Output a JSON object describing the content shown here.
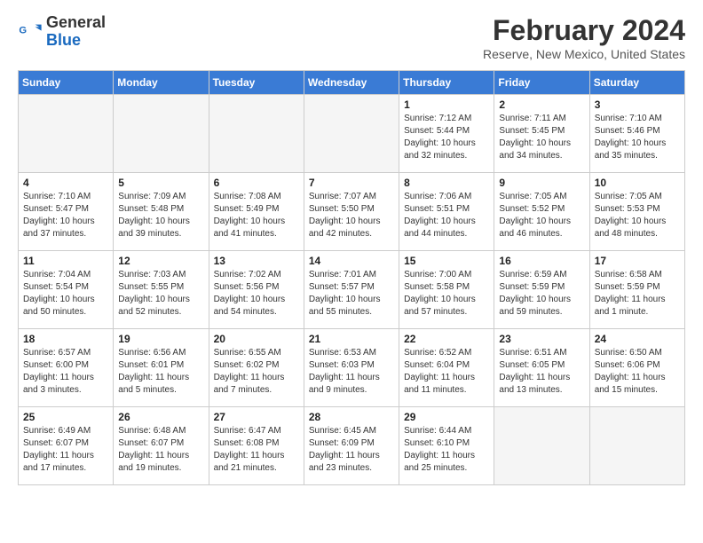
{
  "logo": {
    "line1": "General",
    "line2": "Blue"
  },
  "title": "February 2024",
  "subtitle": "Reserve, New Mexico, United States",
  "weekdays": [
    "Sunday",
    "Monday",
    "Tuesday",
    "Wednesday",
    "Thursday",
    "Friday",
    "Saturday"
  ],
  "weeks": [
    [
      {
        "day": "",
        "info": ""
      },
      {
        "day": "",
        "info": ""
      },
      {
        "day": "",
        "info": ""
      },
      {
        "day": "",
        "info": ""
      },
      {
        "day": "1",
        "info": "Sunrise: 7:12 AM\nSunset: 5:44 PM\nDaylight: 10 hours\nand 32 minutes."
      },
      {
        "day": "2",
        "info": "Sunrise: 7:11 AM\nSunset: 5:45 PM\nDaylight: 10 hours\nand 34 minutes."
      },
      {
        "day": "3",
        "info": "Sunrise: 7:10 AM\nSunset: 5:46 PM\nDaylight: 10 hours\nand 35 minutes."
      }
    ],
    [
      {
        "day": "4",
        "info": "Sunrise: 7:10 AM\nSunset: 5:47 PM\nDaylight: 10 hours\nand 37 minutes."
      },
      {
        "day": "5",
        "info": "Sunrise: 7:09 AM\nSunset: 5:48 PM\nDaylight: 10 hours\nand 39 minutes."
      },
      {
        "day": "6",
        "info": "Sunrise: 7:08 AM\nSunset: 5:49 PM\nDaylight: 10 hours\nand 41 minutes."
      },
      {
        "day": "7",
        "info": "Sunrise: 7:07 AM\nSunset: 5:50 PM\nDaylight: 10 hours\nand 42 minutes."
      },
      {
        "day": "8",
        "info": "Sunrise: 7:06 AM\nSunset: 5:51 PM\nDaylight: 10 hours\nand 44 minutes."
      },
      {
        "day": "9",
        "info": "Sunrise: 7:05 AM\nSunset: 5:52 PM\nDaylight: 10 hours\nand 46 minutes."
      },
      {
        "day": "10",
        "info": "Sunrise: 7:05 AM\nSunset: 5:53 PM\nDaylight: 10 hours\nand 48 minutes."
      }
    ],
    [
      {
        "day": "11",
        "info": "Sunrise: 7:04 AM\nSunset: 5:54 PM\nDaylight: 10 hours\nand 50 minutes."
      },
      {
        "day": "12",
        "info": "Sunrise: 7:03 AM\nSunset: 5:55 PM\nDaylight: 10 hours\nand 52 minutes."
      },
      {
        "day": "13",
        "info": "Sunrise: 7:02 AM\nSunset: 5:56 PM\nDaylight: 10 hours\nand 54 minutes."
      },
      {
        "day": "14",
        "info": "Sunrise: 7:01 AM\nSunset: 5:57 PM\nDaylight: 10 hours\nand 55 minutes."
      },
      {
        "day": "15",
        "info": "Sunrise: 7:00 AM\nSunset: 5:58 PM\nDaylight: 10 hours\nand 57 minutes."
      },
      {
        "day": "16",
        "info": "Sunrise: 6:59 AM\nSunset: 5:59 PM\nDaylight: 10 hours\nand 59 minutes."
      },
      {
        "day": "17",
        "info": "Sunrise: 6:58 AM\nSunset: 5:59 PM\nDaylight: 11 hours\nand 1 minute."
      }
    ],
    [
      {
        "day": "18",
        "info": "Sunrise: 6:57 AM\nSunset: 6:00 PM\nDaylight: 11 hours\nand 3 minutes."
      },
      {
        "day": "19",
        "info": "Sunrise: 6:56 AM\nSunset: 6:01 PM\nDaylight: 11 hours\nand 5 minutes."
      },
      {
        "day": "20",
        "info": "Sunrise: 6:55 AM\nSunset: 6:02 PM\nDaylight: 11 hours\nand 7 minutes."
      },
      {
        "day": "21",
        "info": "Sunrise: 6:53 AM\nSunset: 6:03 PM\nDaylight: 11 hours\nand 9 minutes."
      },
      {
        "day": "22",
        "info": "Sunrise: 6:52 AM\nSunset: 6:04 PM\nDaylight: 11 hours\nand 11 minutes."
      },
      {
        "day": "23",
        "info": "Sunrise: 6:51 AM\nSunset: 6:05 PM\nDaylight: 11 hours\nand 13 minutes."
      },
      {
        "day": "24",
        "info": "Sunrise: 6:50 AM\nSunset: 6:06 PM\nDaylight: 11 hours\nand 15 minutes."
      }
    ],
    [
      {
        "day": "25",
        "info": "Sunrise: 6:49 AM\nSunset: 6:07 PM\nDaylight: 11 hours\nand 17 minutes."
      },
      {
        "day": "26",
        "info": "Sunrise: 6:48 AM\nSunset: 6:07 PM\nDaylight: 11 hours\nand 19 minutes."
      },
      {
        "day": "27",
        "info": "Sunrise: 6:47 AM\nSunset: 6:08 PM\nDaylight: 11 hours\nand 21 minutes."
      },
      {
        "day": "28",
        "info": "Sunrise: 6:45 AM\nSunset: 6:09 PM\nDaylight: 11 hours\nand 23 minutes."
      },
      {
        "day": "29",
        "info": "Sunrise: 6:44 AM\nSunset: 6:10 PM\nDaylight: 11 hours\nand 25 minutes."
      },
      {
        "day": "",
        "info": ""
      },
      {
        "day": "",
        "info": ""
      }
    ]
  ]
}
